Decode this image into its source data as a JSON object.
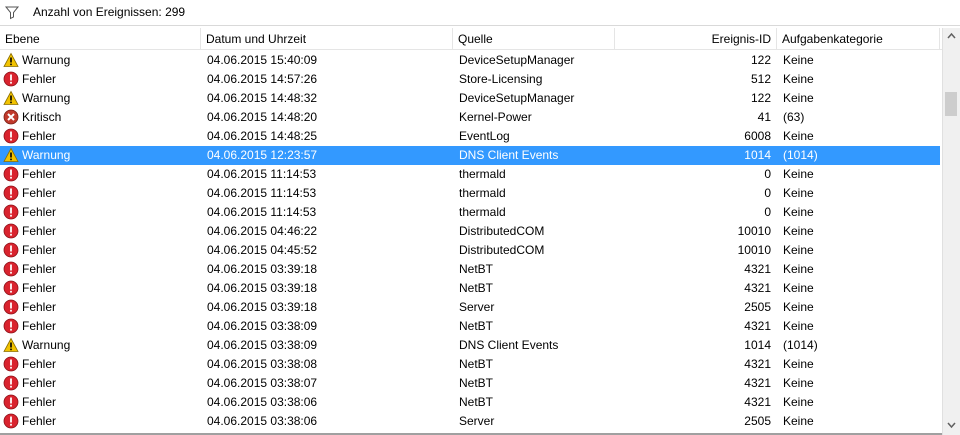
{
  "toolbar": {
    "count_label": "Anzahl von Ereignissen: 299",
    "filter_icon": "filter-icon"
  },
  "columns": {
    "level": "Ebene",
    "datetime": "Datum und Uhrzeit",
    "source": "Quelle",
    "event_id": "Ereignis-ID",
    "category": "Aufgabenkategorie"
  },
  "colors": {
    "selection": "#3399ff",
    "error": "#d9232e",
    "warning": "#f2c300",
    "critical": "#c0392b"
  },
  "rows": [
    {
      "level": "Warnung",
      "type": "warning",
      "datetime": "04.06.2015 15:40:09",
      "source": "DeviceSetupManager",
      "event_id": "122",
      "category": "Keine"
    },
    {
      "level": "Fehler",
      "type": "error",
      "datetime": "04.06.2015 14:57:26",
      "source": "Store-Licensing",
      "event_id": "512",
      "category": "Keine"
    },
    {
      "level": "Warnung",
      "type": "warning",
      "datetime": "04.06.2015 14:48:32",
      "source": "DeviceSetupManager",
      "event_id": "122",
      "category": "Keine"
    },
    {
      "level": "Kritisch",
      "type": "critical",
      "datetime": "04.06.2015 14:48:20",
      "source": "Kernel-Power",
      "event_id": "41",
      "category": "(63)"
    },
    {
      "level": "Fehler",
      "type": "error",
      "datetime": "04.06.2015 14:48:25",
      "source": "EventLog",
      "event_id": "6008",
      "category": "Keine"
    },
    {
      "level": "Warnung",
      "type": "warning",
      "datetime": "04.06.2015 12:23:57",
      "source": "DNS Client Events",
      "event_id": "1014",
      "category": "(1014)",
      "selected": true
    },
    {
      "level": "Fehler",
      "type": "error",
      "datetime": "04.06.2015 11:14:53",
      "source": "thermald",
      "event_id": "0",
      "category": "Keine"
    },
    {
      "level": "Fehler",
      "type": "error",
      "datetime": "04.06.2015 11:14:53",
      "source": "thermald",
      "event_id": "0",
      "category": "Keine"
    },
    {
      "level": "Fehler",
      "type": "error",
      "datetime": "04.06.2015 11:14:53",
      "source": "thermald",
      "event_id": "0",
      "category": "Keine"
    },
    {
      "level": "Fehler",
      "type": "error",
      "datetime": "04.06.2015 04:46:22",
      "source": "DistributedCOM",
      "event_id": "10010",
      "category": "Keine"
    },
    {
      "level": "Fehler",
      "type": "error",
      "datetime": "04.06.2015 04:45:52",
      "source": "DistributedCOM",
      "event_id": "10010",
      "category": "Keine"
    },
    {
      "level": "Fehler",
      "type": "error",
      "datetime": "04.06.2015 03:39:18",
      "source": "NetBT",
      "event_id": "4321",
      "category": "Keine"
    },
    {
      "level": "Fehler",
      "type": "error",
      "datetime": "04.06.2015 03:39:18",
      "source": "NetBT",
      "event_id": "4321",
      "category": "Keine"
    },
    {
      "level": "Fehler",
      "type": "error",
      "datetime": "04.06.2015 03:39:18",
      "source": "Server",
      "event_id": "2505",
      "category": "Keine"
    },
    {
      "level": "Fehler",
      "type": "error",
      "datetime": "04.06.2015 03:38:09",
      "source": "NetBT",
      "event_id": "4321",
      "category": "Keine"
    },
    {
      "level": "Warnung",
      "type": "warning",
      "datetime": "04.06.2015 03:38:09",
      "source": "DNS Client Events",
      "event_id": "1014",
      "category": "(1014)"
    },
    {
      "level": "Fehler",
      "type": "error",
      "datetime": "04.06.2015 03:38:08",
      "source": "NetBT",
      "event_id": "4321",
      "category": "Keine"
    },
    {
      "level": "Fehler",
      "type": "error",
      "datetime": "04.06.2015 03:38:07",
      "source": "NetBT",
      "event_id": "4321",
      "category": "Keine"
    },
    {
      "level": "Fehler",
      "type": "error",
      "datetime": "04.06.2015 03:38:06",
      "source": "NetBT",
      "event_id": "4321",
      "category": "Keine"
    },
    {
      "level": "Fehler",
      "type": "error",
      "datetime": "04.06.2015 03:38:06",
      "source": "Server",
      "event_id": "2505",
      "category": "Keine"
    }
  ]
}
